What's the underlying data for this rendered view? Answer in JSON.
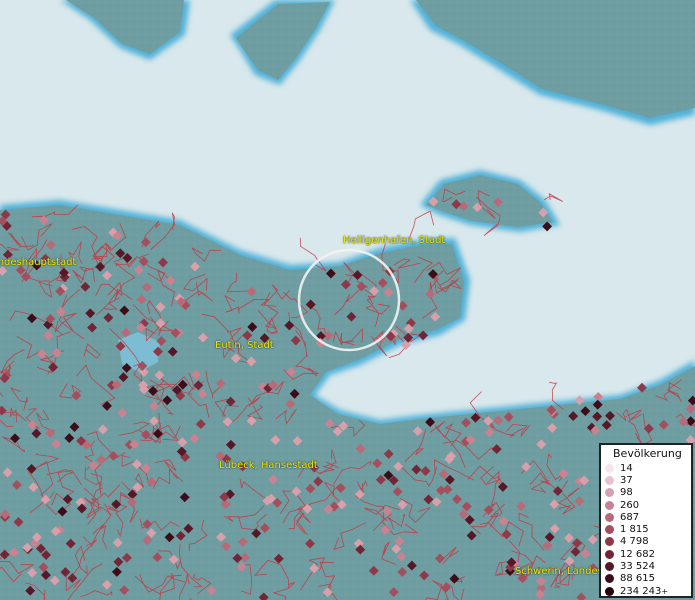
{
  "map": {
    "labels": [
      {
        "id": "heiligenhafen",
        "text": "Heiligenhafen, Stadt"
      },
      {
        "id": "kiel",
        "text": "Landeshauptstadt"
      },
      {
        "id": "eutin",
        "text": "Eutin, Stadt"
      },
      {
        "id": "luebeck",
        "text": "Lübeck, Hansestadt"
      },
      {
        "id": "schwerin",
        "text": "Schwerin, Landes"
      }
    ],
    "colors": {
      "water": "#d9e8ec",
      "land": "#6e9ea1",
      "coast": "#4fb1d8",
      "boundary": "#c8343f",
      "label": "#f2e600"
    }
  },
  "legend": {
    "title": "Bevölkerung",
    "items": [
      {
        "value": "14",
        "color": "#f4e6ea"
      },
      {
        "value": "37",
        "color": "#e7c4cb"
      },
      {
        "value": "98",
        "color": "#d7a0aa"
      },
      {
        "value": "260",
        "color": "#c98390"
      },
      {
        "value": "687",
        "color": "#b86a78"
      },
      {
        "value": "1 815",
        "color": "#a44f5e"
      },
      {
        "value": "4 798",
        "color": "#8e3848"
      },
      {
        "value": "12 682",
        "color": "#722535"
      },
      {
        "value": "33 524",
        "color": "#561826"
      },
      {
        "value": "88 615",
        "color": "#3c0d18"
      },
      {
        "value": "234 243",
        "color": "#22040b"
      }
    ],
    "overflow_mark": "+"
  }
}
